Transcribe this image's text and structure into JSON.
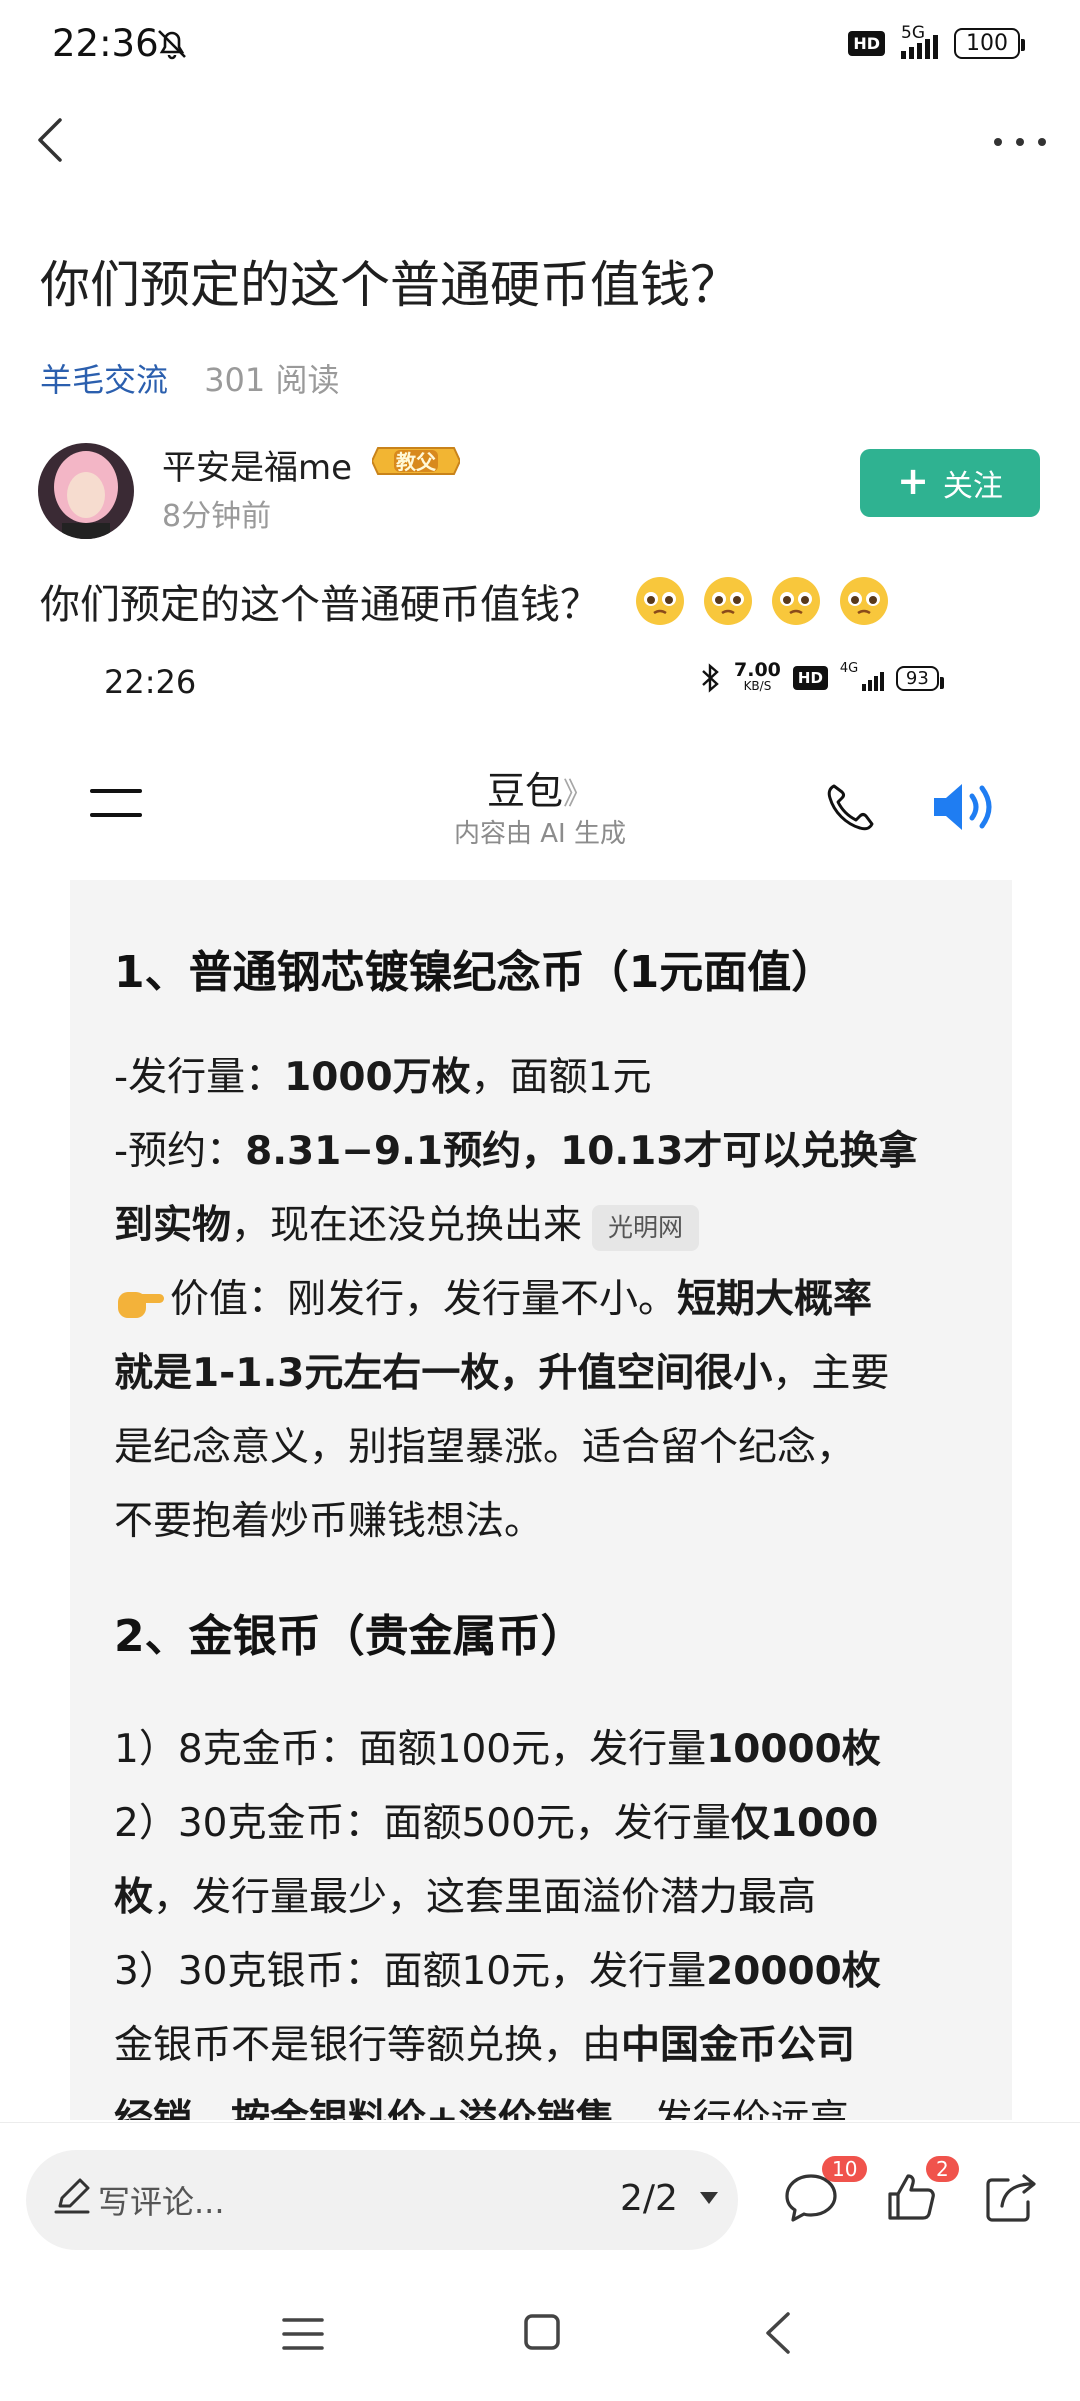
{
  "status_bar": {
    "time": "22:36",
    "network": "5G",
    "hd": "HD",
    "battery": "100"
  },
  "post": {
    "title": "你们预定的这个普通硬币值钱？",
    "category": "羊毛交流",
    "reads": "301 阅读",
    "author": {
      "name": "平安是福me",
      "badge": "教父",
      "time": "8分钟前"
    },
    "follow_label": "关注",
    "body_text": "你们预定的这个普通硬币值钱？"
  },
  "embedded": {
    "time": "22:26",
    "net_speed": "7.00",
    "net_speed_unit": "KB/S",
    "hd": "HD",
    "network": "4G",
    "battery": "93",
    "app_title": "豆包",
    "app_title_arrow": "》",
    "ai_note": "内容由 AI 生成",
    "sections": {
      "s1_heading": "1、普通钢芯镀镍纪念币（1元面值）",
      "s1_l1_a": "-发行量：",
      "s1_l1_b": "1000万枚",
      "s1_l1_c": "，面额1元",
      "s1_l2_a": "-预约：",
      "s1_l2_b": "8.31−9.1预约，10.13才可以兑换拿",
      "s1_l3_b": "到实物",
      "s1_l3_c": "，现在还没兑换出来",
      "source_chip": "光明网",
      "s1_l4_a": "价值：刚发行，发行量不小。",
      "s1_l4_b": "短期大概率",
      "s1_l5_b": "就是1-1.3元左右一枚，升值空间很小",
      "s1_l5_c": "，主要",
      "s1_l6": "是纪念意义，别指望暴涨。适合留个纪念，",
      "s1_l7": "不要抱着炒币赚钱想法。",
      "s2_heading": "2、金银币（贵金属币）",
      "s2_l1_a": "1）8克金币：面额100元，发行量",
      "s2_l1_b": "10000枚",
      "s2_l2_a": "2）30克金币：面额500元，发行量",
      "s2_l2_b": "仅1000",
      "s2_l3_b": "枚",
      "s2_l3_c": "，发行量最少，这套里面溢价潜力最高",
      "s2_l4_a": "3）30克银币：面额10元，发行量",
      "s2_l4_b": "20000枚",
      "s2_l5_a": "金银币不是银行等额兑换，由",
      "s2_l5_b": "中国金币公司",
      "s2_l6_b": "经销，按金银料价+溢价销售",
      "s2_l6_c": "，发行价远高"
    }
  },
  "bottom": {
    "comment_placeholder": "写评论...",
    "pager": "2/2",
    "comment_count": "10",
    "like_count": "2"
  },
  "colors": {
    "accent_green": "#2fb291",
    "link_blue": "#2b5fae",
    "badge_red": "#f0534c",
    "speaker_blue": "#1f7df2"
  }
}
